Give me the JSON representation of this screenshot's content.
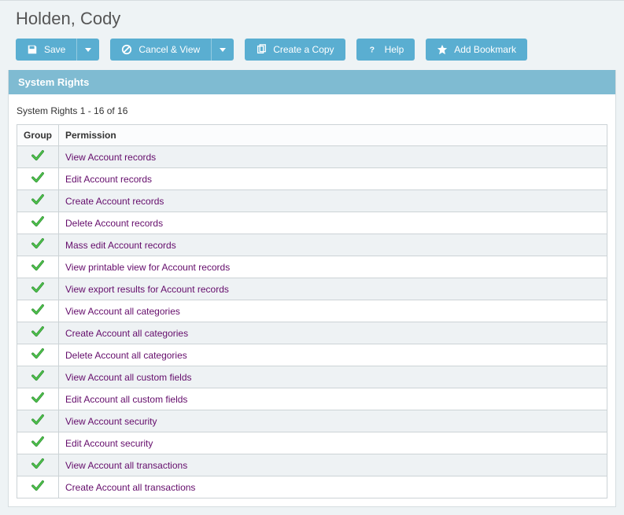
{
  "page_title": "Holden, Cody",
  "toolbar": {
    "save": "Save",
    "cancel_view": "Cancel & View",
    "create_copy": "Create a Copy",
    "help": "Help",
    "add_bookmark": "Add Bookmark"
  },
  "panel": {
    "title": "System Rights",
    "count_text": "System Rights 1 - 16 of 16"
  },
  "table": {
    "col_group": "Group",
    "col_permission": "Permission",
    "rows": [
      {
        "permission": "View Account records"
      },
      {
        "permission": "Edit Account records"
      },
      {
        "permission": "Create Account records"
      },
      {
        "permission": "Delete Account records"
      },
      {
        "permission": "Mass edit Account records"
      },
      {
        "permission": "View printable view for Account records"
      },
      {
        "permission": "View export results for Account records"
      },
      {
        "permission": "View Account all categories"
      },
      {
        "permission": "Create Account all categories"
      },
      {
        "permission": "Delete Account all categories"
      },
      {
        "permission": "View Account all custom fields"
      },
      {
        "permission": "Edit Account all custom fields"
      },
      {
        "permission": "View Account security"
      },
      {
        "permission": "Edit Account security"
      },
      {
        "permission": "View Account all transactions"
      },
      {
        "permission": "Create Account all transactions"
      }
    ]
  }
}
